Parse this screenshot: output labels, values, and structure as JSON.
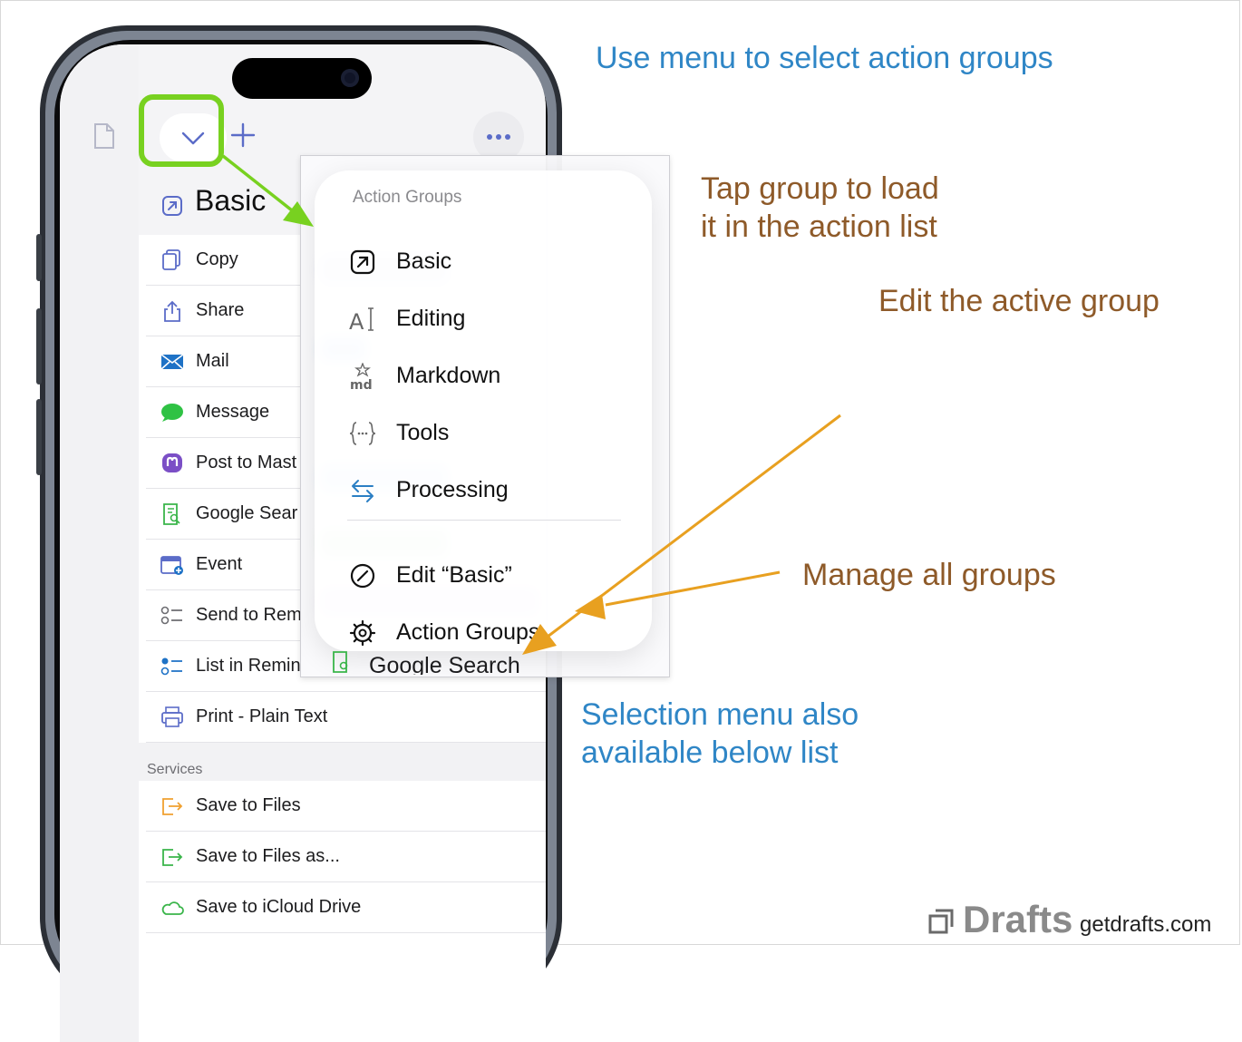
{
  "header": {
    "group_title": "Basic"
  },
  "actions": [
    {
      "label": "Copy",
      "icon": "copy-icon"
    },
    {
      "label": "Share",
      "icon": "share-icon"
    },
    {
      "label": "Mail",
      "icon": "mail-icon"
    },
    {
      "label": "Message",
      "icon": "message-icon"
    },
    {
      "label": "Post to Mast",
      "icon": "mastodon-icon"
    },
    {
      "label": "Google Sear",
      "icon": "google-search-icon"
    },
    {
      "label": "Event",
      "icon": "calendar-icon"
    },
    {
      "label": "Send to Rem",
      "icon": "reminders-icon"
    },
    {
      "label": "List in Remin",
      "icon": "reminders-list-icon"
    },
    {
      "label": "Print - Plain Text",
      "icon": "print-icon"
    }
  ],
  "services_header": "Services",
  "services": [
    {
      "label": "Save to Files",
      "icon": "save-files-icon"
    },
    {
      "label": "Save to Files as...",
      "icon": "save-files-as-icon"
    },
    {
      "label": "Save to iCloud Drive",
      "icon": "icloud-icon"
    }
  ],
  "ghost_row_label": "Google Search",
  "menu": {
    "heading": "Action Groups",
    "groups": [
      {
        "label": "Basic",
        "icon": "arrow-box-icon"
      },
      {
        "label": "Editing",
        "icon": "text-cursor-icon"
      },
      {
        "label": "Markdown",
        "icon": "markdown-icon"
      },
      {
        "label": "Tools",
        "icon": "braces-icon"
      },
      {
        "label": "Processing",
        "icon": "arrows-swap-icon"
      }
    ],
    "edit_label": "Edit “Basic”",
    "manage_label": "Action Groups"
  },
  "annotations": {
    "select_groups": "Use menu to select action groups",
    "tap_group_line1": "Tap group to load",
    "tap_group_line2": "it in the action list",
    "edit_active": "Edit the active group",
    "manage_all": "Manage all groups",
    "selection_line1": "Selection menu also",
    "selection_line2": "available below list"
  },
  "brand": {
    "name": "Drafts",
    "url": "getdrafts.com"
  },
  "colors": {
    "highlight_green": "#78d120",
    "annotation_blue": "#2f86c6",
    "annotation_brown": "#8e5a29",
    "arrow_orange": "#e8a020"
  }
}
